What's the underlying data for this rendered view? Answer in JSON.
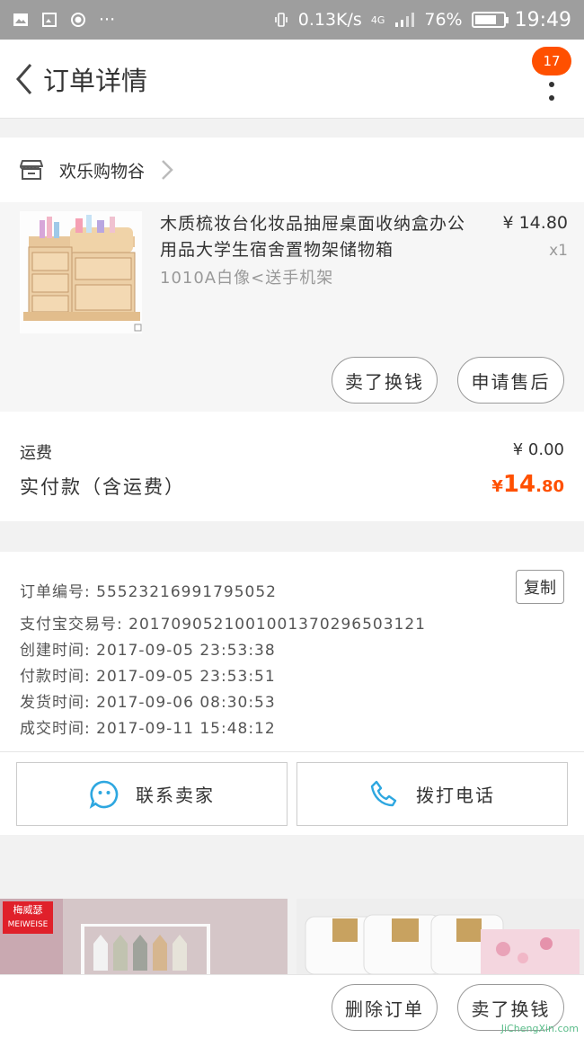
{
  "status_bar": {
    "speed": "0.13K/s",
    "network": "4G",
    "battery": "76%",
    "battery_level": 0.76,
    "time": "19:49"
  },
  "nav": {
    "title": "订单详情",
    "badge_count": "17"
  },
  "shop": {
    "name": "欢乐购物谷"
  },
  "item": {
    "title": "木质梳妆台化妆品抽屉桌面收纳盒办公用品大学生宿舍置物架储物箱",
    "sku": "1010A白像<送手机架",
    "price": "¥ 14.80",
    "quantity": "x1",
    "actions": [
      "卖了换钱",
      "申请售后"
    ]
  },
  "fees": {
    "shipping_label": "运费",
    "shipping_value": "¥ 0.00",
    "total_label": "实付款（含运费）",
    "total_currency": "¥",
    "total_int": "14",
    "total_dec": ".80"
  },
  "order_info": {
    "order_no": "订单编号: 55523216991795052",
    "copy_label": "复制",
    "alipay_no": "支付宝交易号: 2017090521001001370296503121",
    "created": "创建时间: 2017-09-05 23:53:38",
    "paid": "付款时间: 2017-09-05 23:53:51",
    "shipped": "发货时间: 2017-09-06 08:30:53",
    "completed": "成交时间: 2017-09-11 15:48:12"
  },
  "contact": {
    "seller_label": "联系卖家",
    "phone_label": "拨打电话"
  },
  "recommend": {
    "brand_cn": "梅威瑟",
    "brand_en": "MEIWEISE"
  },
  "bottom": {
    "delete_label": "删除订单",
    "sell_label": "卖了换钱"
  },
  "watermark": "JiChengXin.com",
  "colors": {
    "accent": "#ff5000",
    "contact_icon": "#2ea7e0"
  }
}
